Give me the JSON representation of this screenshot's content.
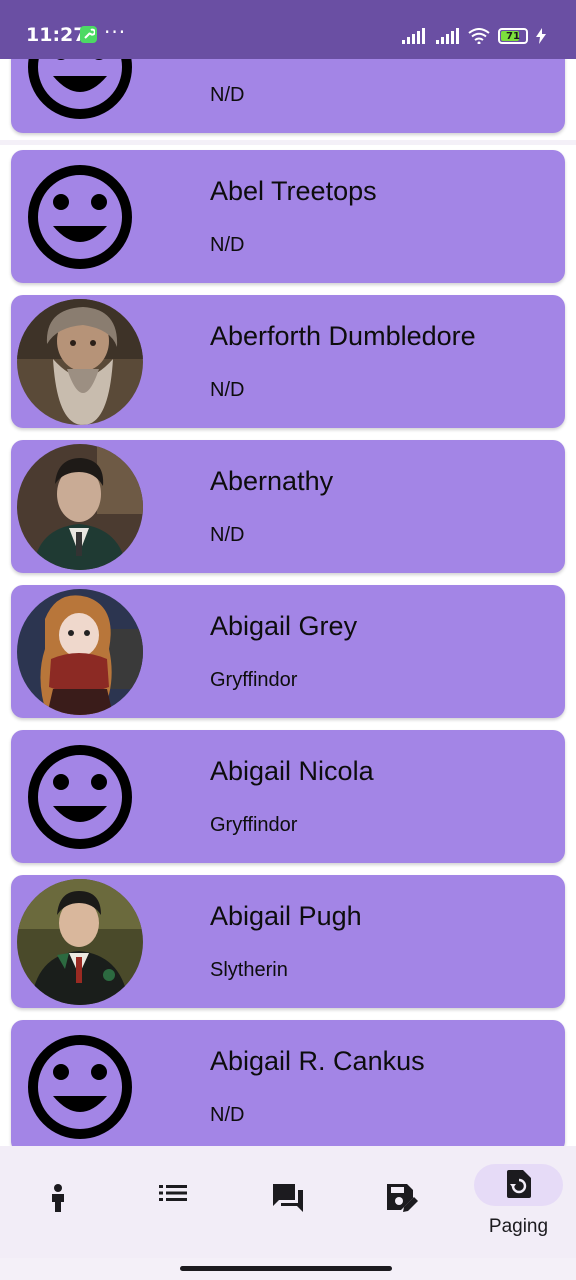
{
  "status_bar": {
    "time": "11:27",
    "dots": "···",
    "battery": "71"
  },
  "characters": [
    {
      "name": "",
      "house": "N/D",
      "avatar": "smiley-icon"
    },
    {
      "name": "Abel Treetops",
      "house": "N/D",
      "avatar": "smiley-icon"
    },
    {
      "name": "Aberforth Dumbledore",
      "house": "N/D",
      "avatar": "photo-old-wizard"
    },
    {
      "name": "Abernathy",
      "house": "N/D",
      "avatar": "photo-dark-haired-man"
    },
    {
      "name": "Abigail Grey",
      "house": "Gryffindor",
      "avatar": "photo-redhead-scarf"
    },
    {
      "name": "Abigail Nicola",
      "house": "Gryffindor",
      "avatar": "smiley-icon"
    },
    {
      "name": "Abigail Pugh",
      "house": "Slytherin",
      "avatar": "photo-slytherin-student"
    },
    {
      "name": "Abigail R. Cankus",
      "house": "N/D",
      "avatar": "smiley-icon"
    }
  ],
  "bottom_nav": {
    "items": [
      {
        "icon": "person-icon",
        "label": ""
      },
      {
        "icon": "list-icon",
        "label": ""
      },
      {
        "icon": "chat-icon",
        "label": ""
      },
      {
        "icon": "save-edit-icon",
        "label": ""
      },
      {
        "icon": "paging-icon",
        "label": "Paging",
        "active": true
      }
    ]
  },
  "colors": {
    "status_bar": "#6a4fa3",
    "card": "#a385e6",
    "nav_bg": "#f2edf7",
    "active_pill": "#e6dbf7"
  }
}
